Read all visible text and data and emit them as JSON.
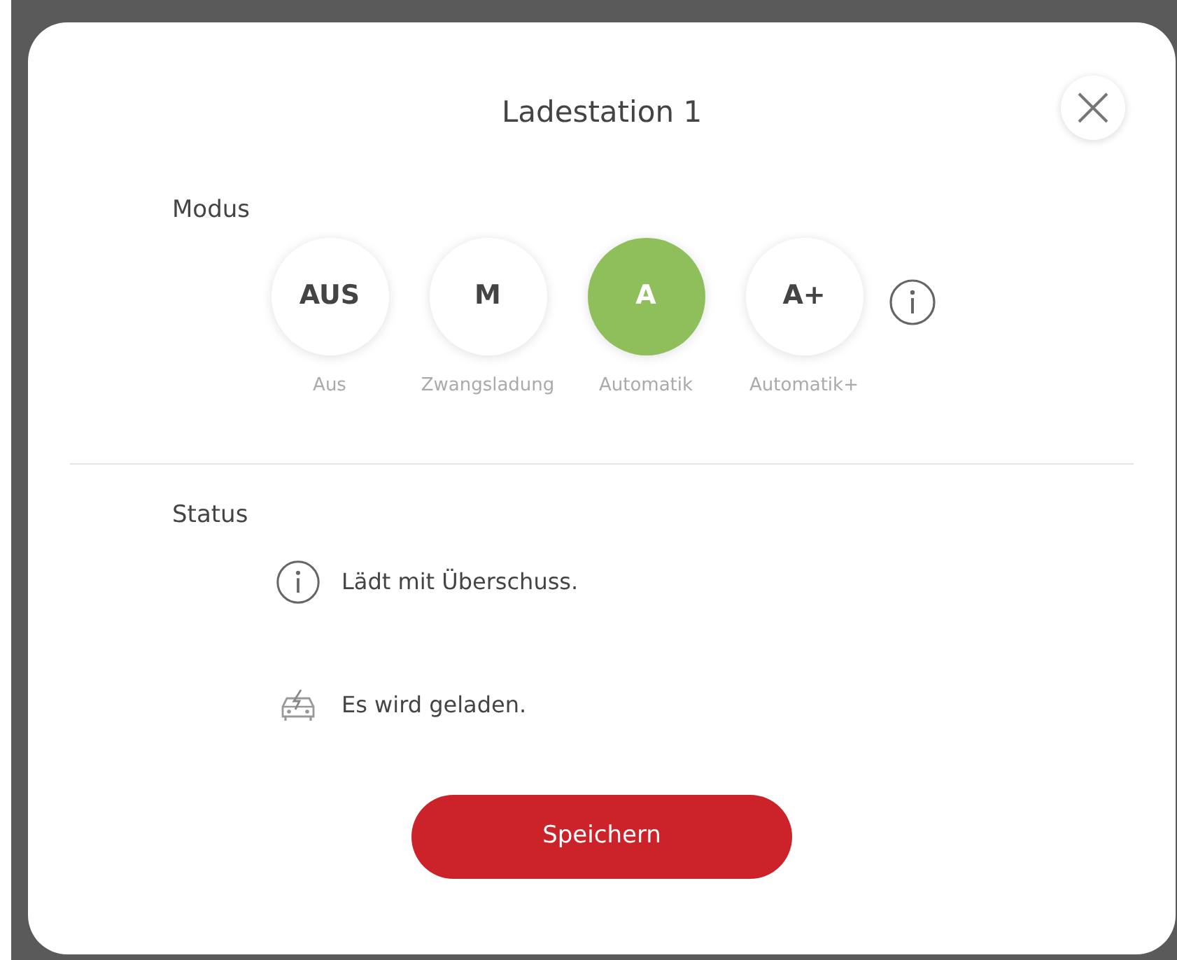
{
  "dialog": {
    "title": "Ladestation 1"
  },
  "mode_section": {
    "label": "Modus",
    "modes": [
      {
        "code": "AUS",
        "caption": "Aus",
        "selected": false
      },
      {
        "code": "M",
        "caption": "Zwangsladung",
        "selected": false
      },
      {
        "code": "A",
        "caption": "Automatik",
        "selected": true
      },
      {
        "code": "A+",
        "caption": "Automatik+",
        "selected": false
      }
    ]
  },
  "status_section": {
    "label": "Status",
    "items": [
      {
        "kind": "info",
        "text": "Lädt mit Überschuss."
      },
      {
        "kind": "charging",
        "text": "Es wird geladen."
      }
    ]
  },
  "save_button": "Speichern"
}
